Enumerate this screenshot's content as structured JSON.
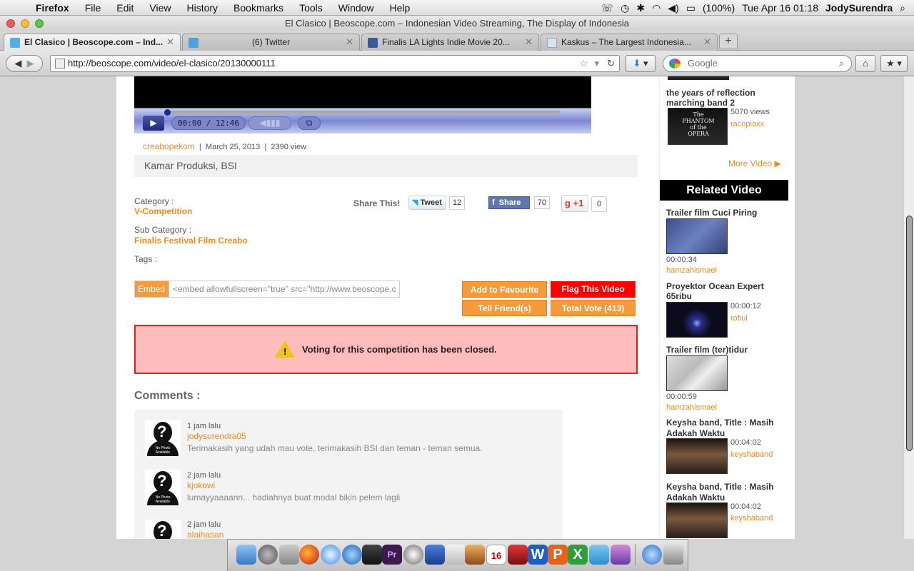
{
  "menubar": {
    "app": "Firefox",
    "items": [
      "File",
      "Edit",
      "View",
      "History",
      "Bookmarks",
      "Tools",
      "Window",
      "Help"
    ],
    "battery": "(100%)",
    "datetime": "Tue Apr 16  01:18",
    "user": "JodySurendra"
  },
  "window": {
    "title": "El Clasico | Beoscope.com – Indonesian Video Streaming, The Display of Indonesia"
  },
  "tabs": [
    {
      "label": "El Clasico | Beoscope.com – Ind...",
      "icon": "beoscope-icon",
      "active": true
    },
    {
      "label": "(6) Twitter",
      "icon": "twitter-icon",
      "active": false
    },
    {
      "label": "Finalis LA Lights Indie Movie 20...",
      "icon": "facebook-icon",
      "active": false
    },
    {
      "label": "Kaskus – The Largest Indonesia...",
      "icon": "kaskus-icon",
      "active": false
    }
  ],
  "nav": {
    "url": "http://beoscope.com/video/el-clasico/20130000111",
    "search_placeholder": "Google"
  },
  "player": {
    "time": "00:00 / 12:46"
  },
  "video_meta": {
    "author": "creabopekom",
    "sep": "|",
    "date": "March 25, 2013",
    "views": "2390 view",
    "title": "Kamar Produksi, BSI"
  },
  "details": {
    "category_label": "Category :",
    "category_value": "V-Competition",
    "subcategory_label": "Sub Category :",
    "subcategory_value": "Finalis Festival Film Creabo",
    "tags_label": "Tags :"
  },
  "share": {
    "label": "Share This!",
    "tweet": "Tweet",
    "tweet_count": "12",
    "fb_share": "Share",
    "fb_count": "70",
    "gplus": "+1",
    "gplus_count": "0"
  },
  "embed": {
    "label": "Embed",
    "code": "<embed allowfullscreen=\"true\" src=\"http://www.beoscope.c"
  },
  "actions": {
    "favourite": "Add to Favourite",
    "flag": "Flag This Video",
    "tell": "Tell Friend(s)",
    "total_vote": "Total Vote (413)"
  },
  "notice": {
    "text": "Voting for this competition has been closed."
  },
  "comments": {
    "heading": "Comments :",
    "items": [
      {
        "time": "1 jam lalu",
        "user": "jodysurendra05",
        "text": "Terimakasih yang udah mau vote, terimakasih BSI dan teman - teman semua."
      },
      {
        "time": "2 jam lalu",
        "user": "kjokowi",
        "text": "lumayyaaaann... hadiahnya buat modal bikin pelem lagii"
      },
      {
        "time": "2 jam lalu",
        "user": "alaihasan",
        "text": ""
      }
    ]
  },
  "sidebar": {
    "top_item": {
      "title": "the years of reflection marching band 2",
      "views": "5070 views",
      "user": "racoplaxx"
    },
    "more_video": "More Video",
    "related_heading": "Related Video",
    "related": [
      {
        "title": "Trailer film Cuci Piring",
        "duration": "00:00:34",
        "user": "hamzahismael"
      },
      {
        "title": "Proyektor Ocean Expert 65ribu",
        "duration": "00:00:12",
        "user": "rofiul"
      },
      {
        "title": "Trailer film (ter)tidur",
        "duration": "00:00:59",
        "user": "hamzahismael"
      },
      {
        "title": "Keysha band, Title : Masih Adakah Waktu",
        "duration": "00:04:02",
        "user": "keyshaband"
      },
      {
        "title": "Keysha band, Title : Masih Adakah Waktu",
        "duration": "00:04:02",
        "user": "keyshaband"
      }
    ]
  },
  "colors": {
    "accent": "#f28a1d",
    "flag_red": "#ff0000",
    "notice_bg": "#ffbcbc",
    "notice_border": "#e02020"
  }
}
